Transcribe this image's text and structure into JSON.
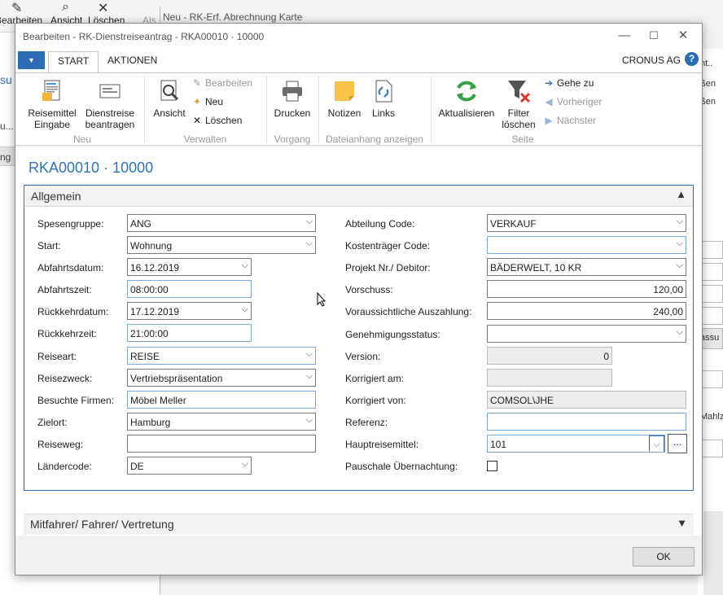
{
  "background": {
    "ribbon_buttons": [
      "Bearbeiten",
      "Ansicht",
      "Löschen",
      "Als"
    ],
    "left_texts": [
      "su",
      "u...",
      "ng"
    ],
    "window2_title": "Neu - RK-Erf. Abrechnung Karte",
    "right_texts": [
      "ht..",
      "ßen",
      "ßen",
      "assu",
      "Mahlz"
    ]
  },
  "dialog": {
    "title": "Bearbeiten - RK-Dienstreiseantrag - RKA00010 · 10000",
    "minimize": "—",
    "maximize": "☐",
    "close": "✕"
  },
  "ribbon": {
    "menu_icon": "▼",
    "tabs": [
      "START",
      "AKTIONEN"
    ],
    "company": "CRONUS AG",
    "help": "?",
    "groups": {
      "neu": {
        "label": "Neu",
        "reisemittel": "Reisemittel Eingabe",
        "dienstreise": "Dienstreise beantragen"
      },
      "verwalten": {
        "label": "Verwalten",
        "ansicht": "Ansicht",
        "bearbeiten": "Bearbeiten",
        "neu": "Neu",
        "loeschen": "Löschen"
      },
      "vorgang": {
        "label": "Vorgang",
        "drucken": "Drucken"
      },
      "dateianhang": {
        "label": "Dateianhang anzeigen",
        "notizen": "Notizen",
        "links": "Links"
      },
      "seite": {
        "label": "Seite",
        "aktualisieren": "Aktualisieren",
        "filter": "Filter löschen",
        "gehe_zu": "Gehe zu",
        "vorheriger": "Vorheriger",
        "naechster": "Nächster"
      }
    }
  },
  "page": {
    "title": "RKA00010 · 10000",
    "section_general": "Allgemein",
    "section_collapse": "▲",
    "section_other": "Mitfahrer/ Fahrer/ Vertretung",
    "section_expand": "▼"
  },
  "left_fields": [
    {
      "label": "Spesengruppe:",
      "value": "ANG"
    },
    {
      "label": "Start:",
      "value": "Wohnung"
    },
    {
      "label": "Abfahrtsdatum:",
      "value": "16.12.2019"
    },
    {
      "label": "Abfahrtszeit:",
      "value": "08:00:00"
    },
    {
      "label": "Rückkehrdatum:",
      "value": "17.12.2019"
    },
    {
      "label": "Rückkehrzeit:",
      "value": "21:00:00"
    },
    {
      "label": "Reiseart:",
      "value": "REISE"
    },
    {
      "label": "Reisezweck:",
      "value": "Vertriebspräsentation"
    },
    {
      "label": "Besuchte Firmen:",
      "value": "Möbel Meller"
    },
    {
      "label": "Zielort:",
      "value": "Hamburg"
    },
    {
      "label": "Reiseweg:",
      "value": ""
    },
    {
      "label": "Ländercode:",
      "value": "DE"
    }
  ],
  "right_fields": [
    {
      "label": "Abteilung Code:",
      "value": "VERKAUF"
    },
    {
      "label": "Kostenträger Code:",
      "value": ""
    },
    {
      "label": "Projekt Nr./ Debitor:",
      "value": "BÄDERWELT, 10 KR"
    },
    {
      "label": "Vorschuss:",
      "value": "120,00"
    },
    {
      "label": "Voraussichtliche Auszahlung:",
      "value": "240,00"
    },
    {
      "label": "Genehmigungsstatus:",
      "value": ""
    },
    {
      "label": "Version:",
      "value": "0"
    },
    {
      "label": "Korrigiert am:",
      "value": ""
    },
    {
      "label": "Korrigiert von:",
      "value": "COMSOL\\JHE"
    },
    {
      "label": "Referenz:",
      "value": ""
    },
    {
      "label": "Hauptreisemittel:",
      "value": "101"
    },
    {
      "label": "Pauschale Übernachtung:",
      "value": ""
    }
  ],
  "dropdown_glyph": "⌵",
  "ellipsis": "...",
  "ok": "OK"
}
